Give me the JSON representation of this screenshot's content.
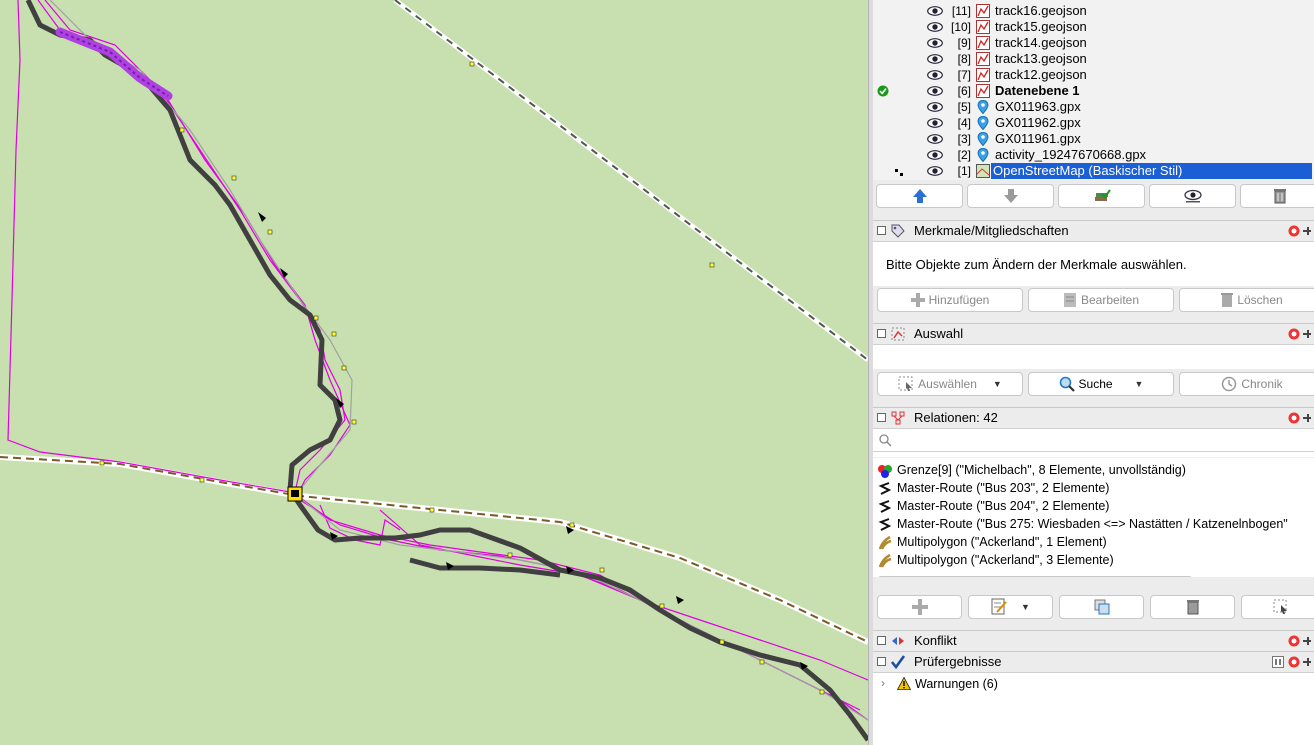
{
  "layers": [
    {
      "index": "[11]",
      "name": "track16.geojson",
      "type": "data",
      "bold": false,
      "selected": false,
      "active": false
    },
    {
      "index": "[10]",
      "name": "track15.geojson",
      "type": "data",
      "bold": false,
      "selected": false,
      "active": false
    },
    {
      "index": "[9]",
      "name": "track14.geojson",
      "type": "data",
      "bold": false,
      "selected": false,
      "active": false
    },
    {
      "index": "[8]",
      "name": "track13.geojson",
      "type": "data",
      "bold": false,
      "selected": false,
      "active": false
    },
    {
      "index": "[7]",
      "name": "track12.geojson",
      "type": "data",
      "bold": false,
      "selected": false,
      "active": false
    },
    {
      "index": "[6]",
      "name": "Datenebene 1",
      "type": "data",
      "bold": true,
      "selected": false,
      "active": true
    },
    {
      "index": "[5]",
      "name": "GX011963.gpx",
      "type": "gpx",
      "bold": false,
      "selected": false,
      "active": false
    },
    {
      "index": "[4]",
      "name": "GX011962.gpx",
      "type": "gpx",
      "bold": false,
      "selected": false,
      "active": false
    },
    {
      "index": "[3]",
      "name": "GX011961.gpx",
      "type": "gpx",
      "bold": false,
      "selected": false,
      "active": false
    },
    {
      "index": "[2]",
      "name": "activity_19247670668.gpx",
      "type": "gpx",
      "bold": false,
      "selected": false,
      "active": false
    },
    {
      "index": "[1]",
      "name": "OpenStreetMap (Baskischer Stil)",
      "type": "imagery",
      "bold": false,
      "selected": true,
      "active": false
    }
  ],
  "properties": {
    "title": "Merkmale/Mitgliedschaften",
    "message": "Bitte Objekte zum Ändern der Merkmale auswählen.",
    "add_label": "Hinzufügen",
    "edit_label": "Bearbeiten",
    "delete_label": "Löschen"
  },
  "selection": {
    "title": "Auswahl",
    "select_label": "Auswählen",
    "search_label": "Suche",
    "history_label": "Chronik"
  },
  "relations": {
    "title": "Relationen: 42",
    "search_placeholder": "",
    "items": [
      {
        "text": "Grenze[9] (\"Michelbach\", 8 Elemente, unvollständig)",
        "icon": "boundary-icon"
      },
      {
        "text": "Master-Route (\"Bus 203\", 2 Elemente)",
        "icon": "route-icon"
      },
      {
        "text": "Master-Route (\"Bus 204\", 2 Elemente)",
        "icon": "route-icon"
      },
      {
        "text": "Master-Route (\"Bus 275: Wiesbaden <=> Nastätten / Katzenelnbogen\"",
        "icon": "route-icon"
      },
      {
        "text": "Multipolygon (\"Ackerland\", 1 Element)",
        "icon": "farmland-icon"
      },
      {
        "text": "Multipolygon (\"Ackerland\", 3 Elemente)",
        "icon": "farmland-icon"
      }
    ]
  },
  "conflict": {
    "title": "Konflikt"
  },
  "validator": {
    "title": "Prüfergebnisse",
    "warnings": "Warnungen (6)"
  },
  "colors": {
    "map_bg": "#c8e0b0",
    "track_gpx": "#404040",
    "track_geojson": "#e000e0",
    "selection": "#1a5fd6"
  }
}
